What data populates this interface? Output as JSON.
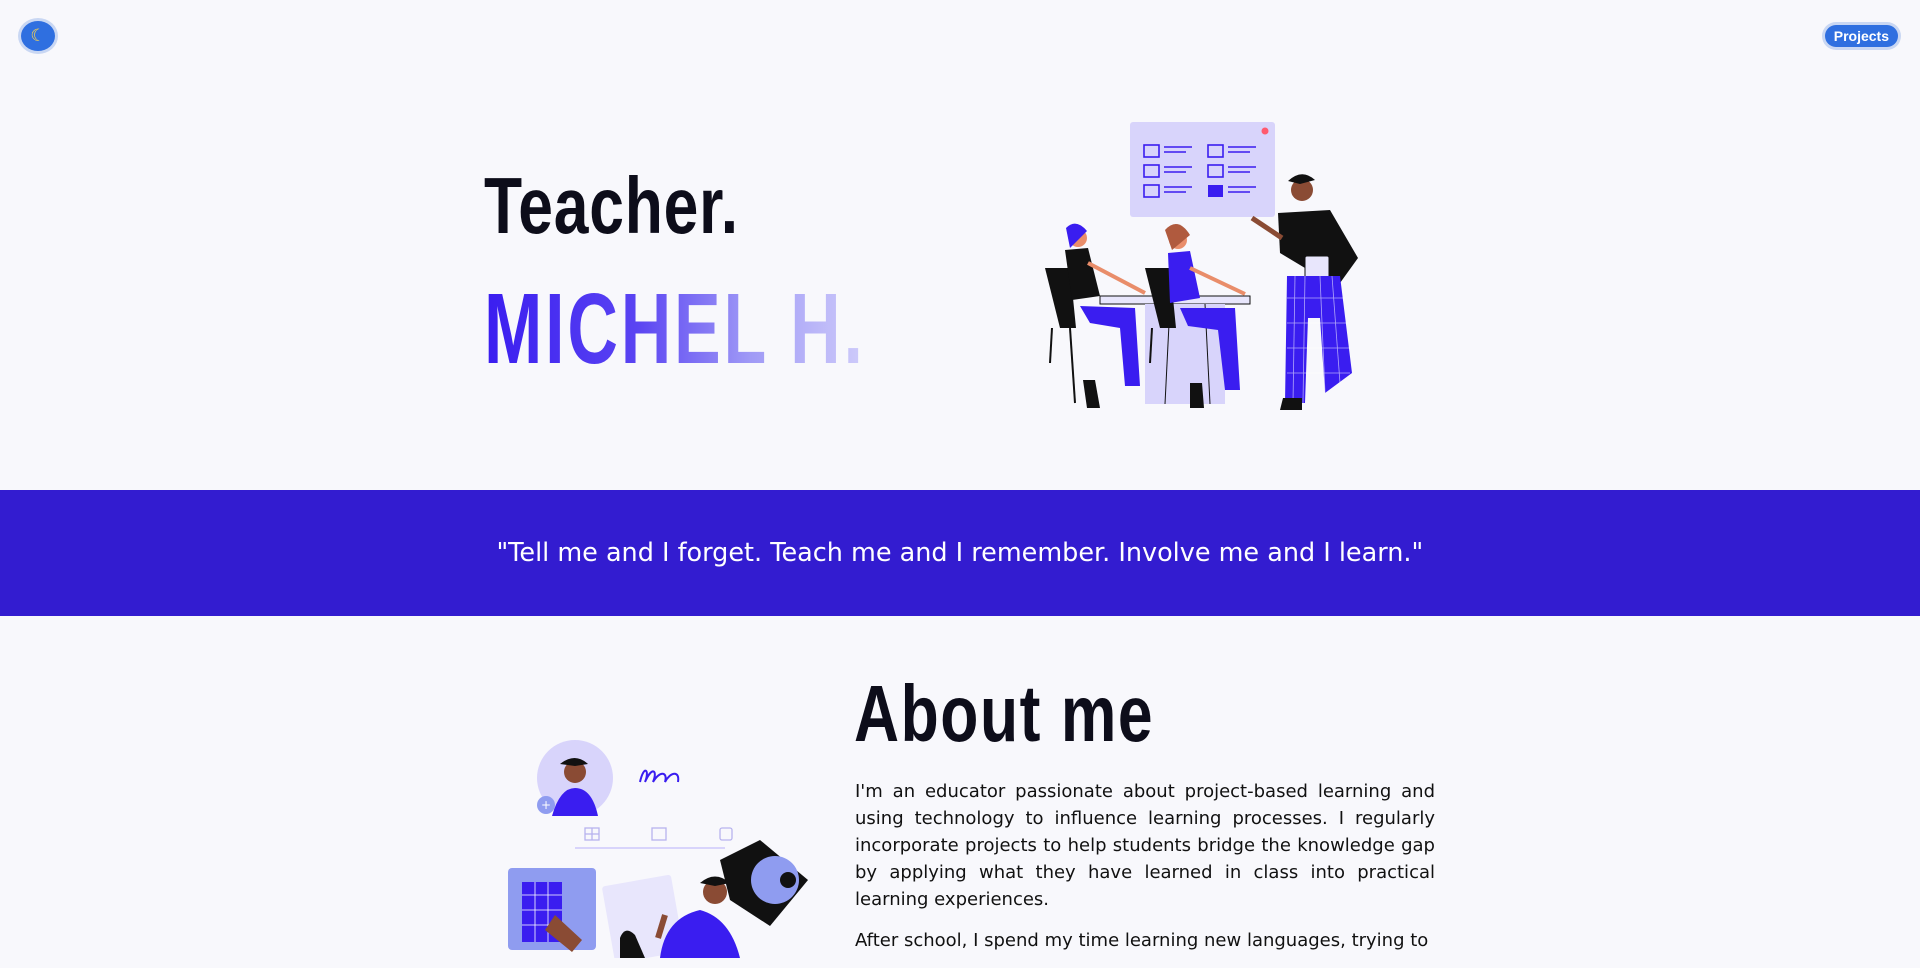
{
  "header": {
    "theme_toggle_icon": "moon-icon",
    "projects_label": "Projects"
  },
  "hero": {
    "role": "Teacher.",
    "name": "MICHEL H.",
    "illustration": "classroom-illustration"
  },
  "quote": {
    "text": "\"Tell me and I forget. Teach me and I remember. Involve me and I learn.\""
  },
  "about": {
    "title": "About me",
    "paragraphs": [
      "I'm an educator passionate about project-based learning and using technology to influence learning processes. I regularly incorporate projects to help students bridge the knowledge gap by applying what they have learned in class into practical learning experiences.",
      "After school, I spend my time learning new languages, trying to"
    ],
    "illustration": "profile-dashboard-illustration"
  },
  "colors": {
    "accent": "#331cd0",
    "button": "#2f6fe0",
    "background": "#f8f8fc"
  }
}
